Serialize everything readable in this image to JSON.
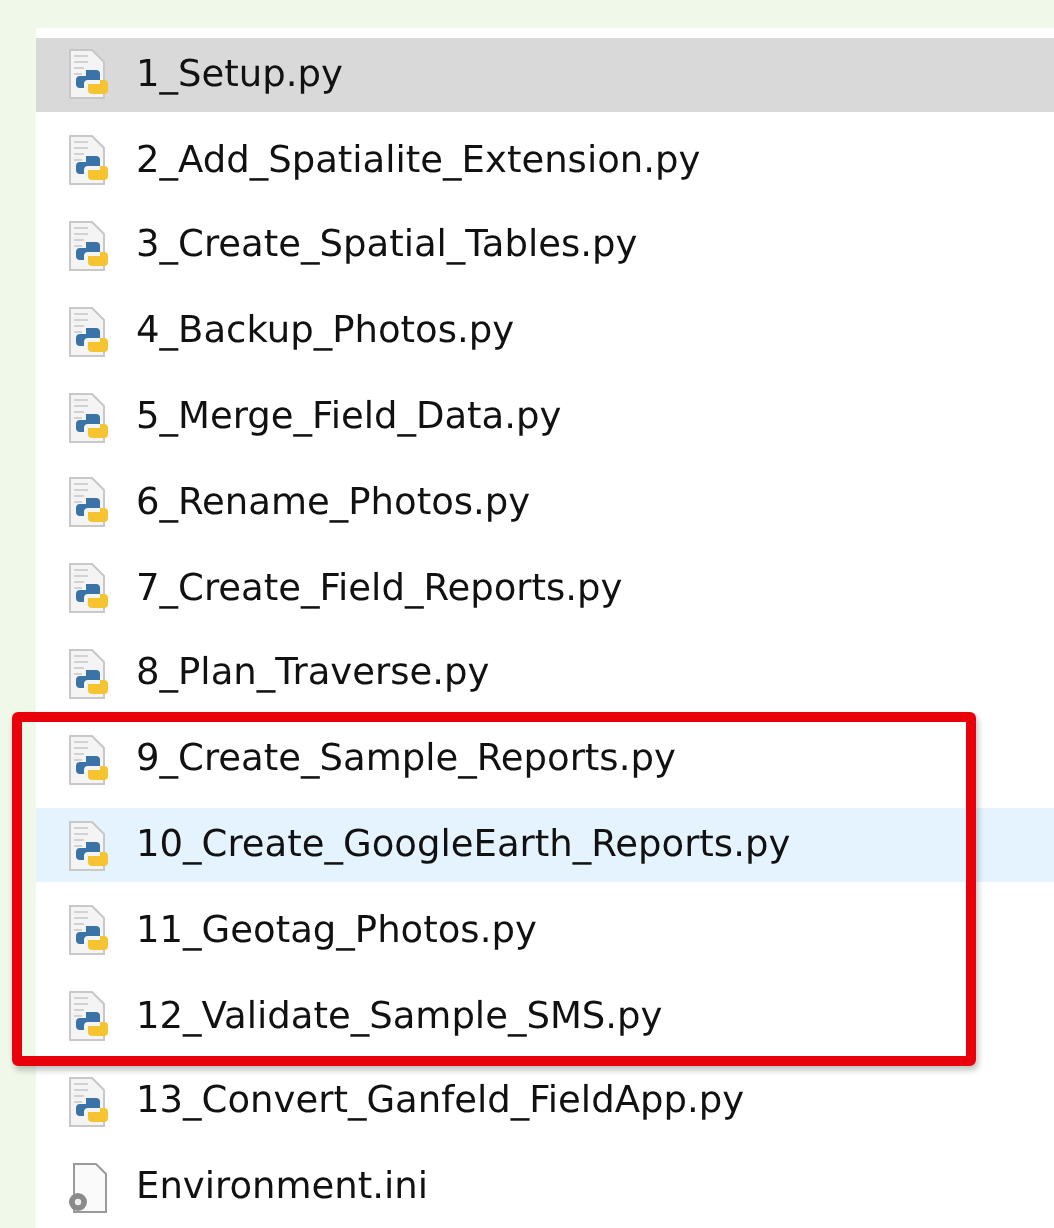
{
  "files": [
    {
      "name": "1_Setup.py",
      "kind": "python",
      "selected": true,
      "hovered": false,
      "highlighted": false
    },
    {
      "name": "2_Add_Spatialite_Extension.py",
      "kind": "python",
      "selected": false,
      "hovered": false,
      "highlighted": false
    },
    {
      "name": "3_Create_Spatial_Tables.py",
      "kind": "python",
      "selected": false,
      "hovered": false,
      "highlighted": false
    },
    {
      "name": "4_Backup_Photos.py",
      "kind": "python",
      "selected": false,
      "hovered": false,
      "highlighted": false
    },
    {
      "name": "5_Merge_Field_Data.py",
      "kind": "python",
      "selected": false,
      "hovered": false,
      "highlighted": false
    },
    {
      "name": "6_Rename_Photos.py",
      "kind": "python",
      "selected": false,
      "hovered": false,
      "highlighted": false
    },
    {
      "name": "7_Create_Field_Reports.py",
      "kind": "python",
      "selected": false,
      "hovered": false,
      "highlighted": false
    },
    {
      "name": "8_Plan_Traverse.py",
      "kind": "python",
      "selected": false,
      "hovered": false,
      "highlighted": false
    },
    {
      "name": "9_Create_Sample_Reports.py",
      "kind": "python",
      "selected": false,
      "hovered": false,
      "highlighted": true
    },
    {
      "name": "10_Create_GoogleEarth_Reports.py",
      "kind": "python",
      "selected": false,
      "hovered": true,
      "highlighted": true
    },
    {
      "name": "11_Geotag_Photos.py",
      "kind": "python",
      "selected": false,
      "hovered": false,
      "highlighted": true
    },
    {
      "name": "12_Validate_Sample_SMS.py",
      "kind": "python",
      "selected": false,
      "hovered": false,
      "highlighted": true
    },
    {
      "name": "13_Convert_Ganfeld_FieldApp.py",
      "kind": "python",
      "selected": false,
      "hovered": false,
      "highlighted": false
    },
    {
      "name": "Environment.ini",
      "kind": "config",
      "selected": false,
      "hovered": false,
      "highlighted": false
    }
  ]
}
